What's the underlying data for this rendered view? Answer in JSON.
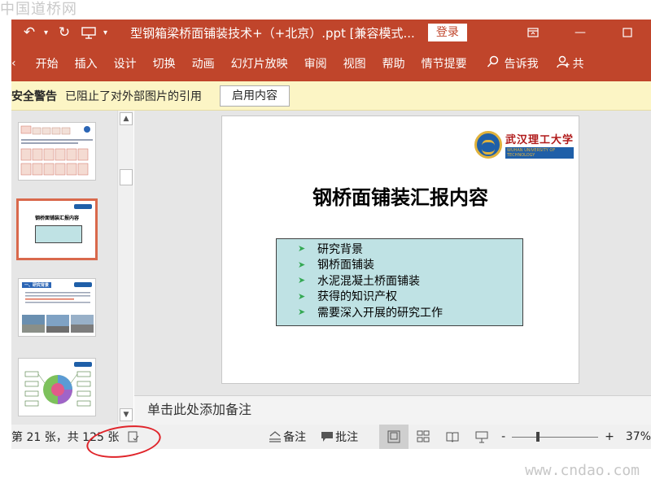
{
  "watermarks": {
    "top": "中国道桥网",
    "bottom": "www.cndao.com"
  },
  "titlebar": {
    "undo_icon": "undo-icon",
    "redo_icon": "redo-icon",
    "presenter_icon": "presenter-icon",
    "doc_title": "型钢箱梁桥面铺装技术+（+北京）.ppt [兼容模式...",
    "login_label": "登录",
    "restore_icon": "ribbon-display-icon",
    "minimize_icon": "minimize-icon",
    "maximize_icon": "maximize-icon",
    "bg_color": "#c0452b"
  },
  "ribbon": {
    "tabs": [
      "开始",
      "插入",
      "设计",
      "切换",
      "动画",
      "幻灯片放映",
      "审阅",
      "视图",
      "帮助",
      "情节提要"
    ],
    "tell_me": "告诉我",
    "share": "共"
  },
  "security_bar": {
    "title": "安全警告",
    "message": "已阻止了对外部图片的引用",
    "enable_button": "启用内容"
  },
  "slide": {
    "title": "钢桥面铺装汇报内容",
    "logo_text": "武汉理工大学",
    "logo_subtext": "WUHAN UNIVERSITY OF TECHNOLOGY",
    "bullets": [
      "研究背景",
      "钢桥面铺装",
      "水泥混凝土桥面铺装",
      "获得的知识产权",
      "需要深入开展的研究工作"
    ],
    "bullet_box_color": "#bfe2e4",
    "bullet_arrow_color": "#34a853"
  },
  "thumbnails": {
    "thumb2_title": "钢桥面铺装汇报内容",
    "thumb3_title": "一、研究背景"
  },
  "notes": {
    "placeholder": "单击此处添加备注"
  },
  "statusbar": {
    "slide_count": "第 21 张，共 125 张",
    "notes_label": "备注",
    "comments_label": "批注",
    "zoom_minus": "-",
    "zoom_plus": "+",
    "zoom_percent": "37%",
    "zoom_level": 0.37
  },
  "annotation": {
    "highlight_color": "#e0242a"
  }
}
